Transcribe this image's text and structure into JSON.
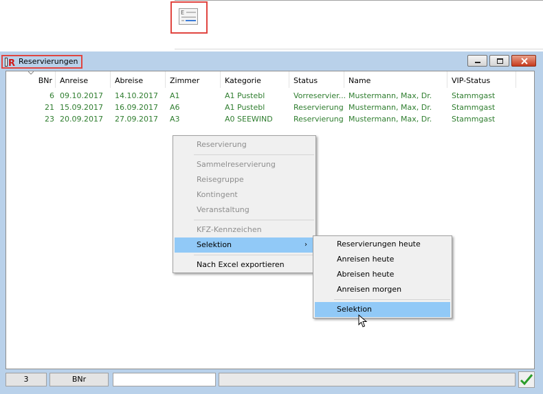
{
  "window": {
    "title": "Reservierungen"
  },
  "table": {
    "columns": [
      "BNr",
      "Anreise",
      "Abreise",
      "Zimmer",
      "Kategorie",
      "Status",
      "Name",
      "VIP-Status"
    ],
    "rows": [
      {
        "bnr": "6",
        "anreise": "09.10.2017",
        "abreise": "14.10.2017",
        "zimmer": "A1",
        "kategorie": "A1 Pustebl",
        "status": "Vorreservier...",
        "name": "Mustermann, Max, Dr.",
        "vip": "Stammgast"
      },
      {
        "bnr": "21",
        "anreise": "15.09.2017",
        "abreise": "16.09.2017",
        "zimmer": "A6",
        "kategorie": "A1 Pustebl",
        "status": "Reservierung",
        "name": "Mustermann, Max, Dr.",
        "vip": "Stammgast"
      },
      {
        "bnr": "23",
        "anreise": "20.09.2017",
        "abreise": "27.09.2017",
        "zimmer": "A3",
        "kategorie": "A0 SEEWIND",
        "status": "Reservierung",
        "name": "Mustermann, Max, Dr.",
        "vip": "Stammgast"
      }
    ],
    "row_color": "#2e7d2e"
  },
  "context_menu": {
    "items": [
      "Reservierung",
      "Sammelreservierung",
      "Reisegruppe",
      "Kontingent",
      "Veranstaltung",
      "KFZ-Kennzeichen",
      "Selektion",
      "Nach Excel exportieren"
    ],
    "selected": "Selektion"
  },
  "submenu": {
    "items": [
      "Reservierungen heute",
      "Anreisen heute",
      "Abreisen heute",
      "Anreisen morgen",
      "Selektion"
    ],
    "selected": "Selektion"
  },
  "statusbar": {
    "count": "3",
    "sort_field": "BNr",
    "search_value": ""
  },
  "colors": {
    "highlight": "#91c9f7",
    "annotation": "#e0443f",
    "window_frame": "#b9d1ea",
    "ok_check": "#2a9d2a"
  }
}
